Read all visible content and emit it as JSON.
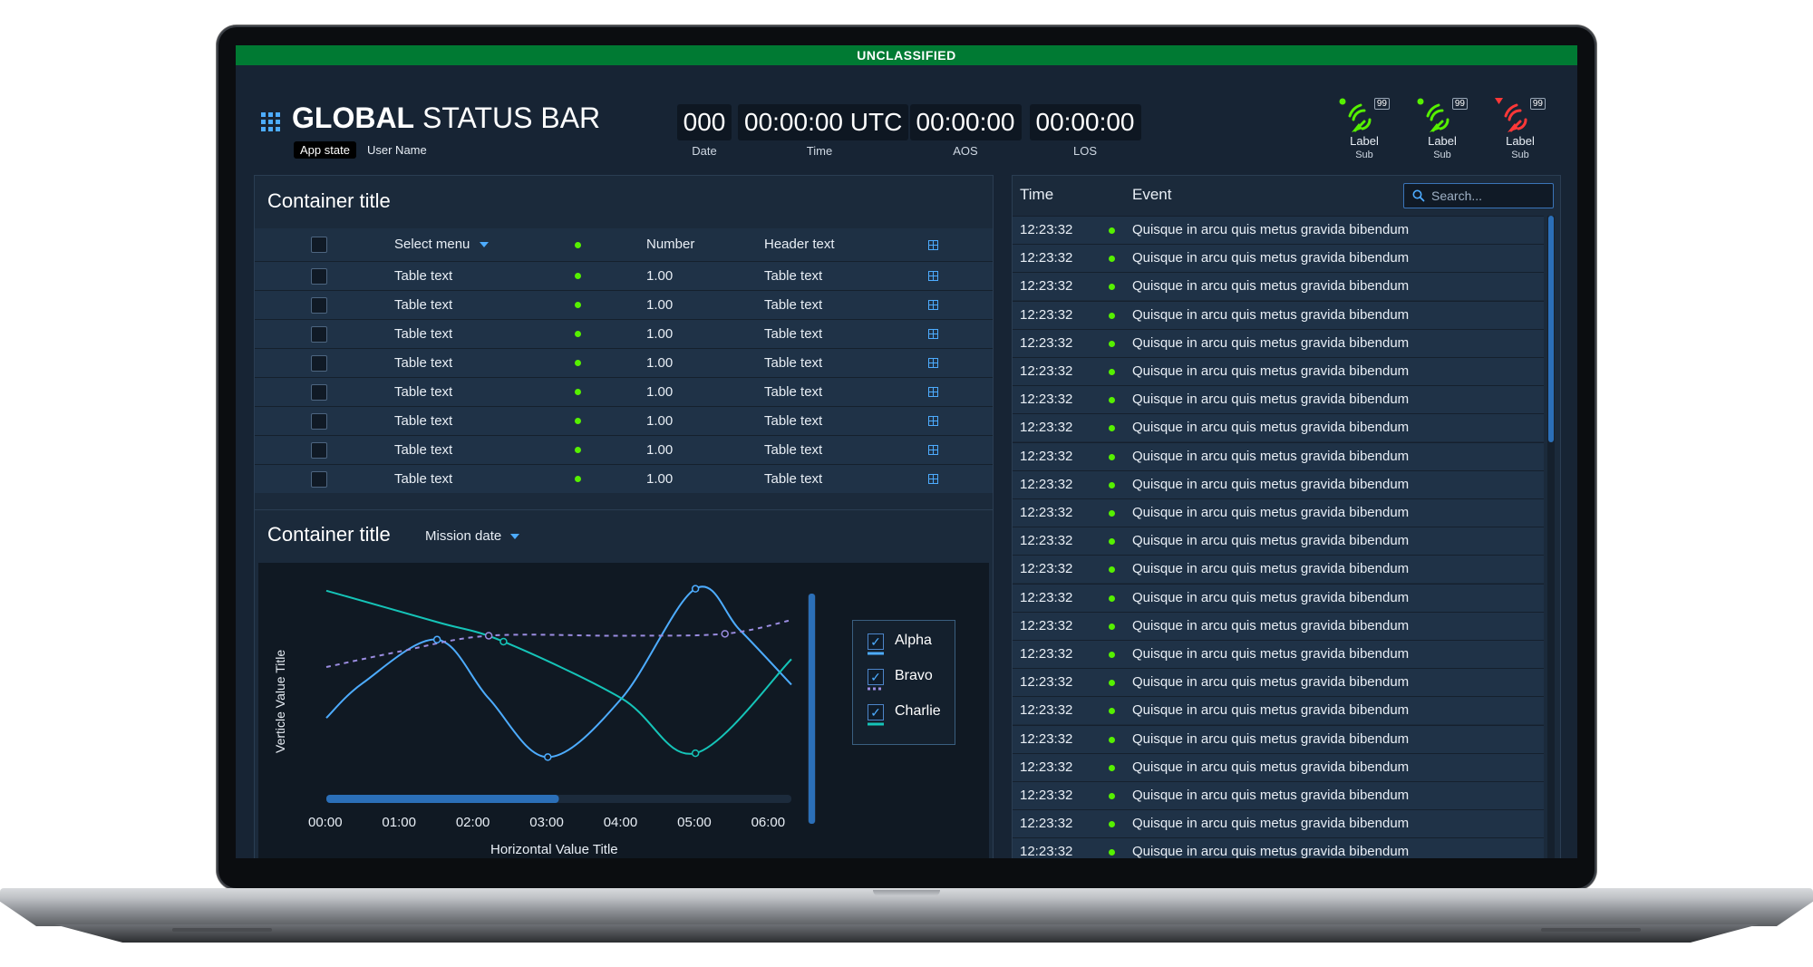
{
  "classification": "UNCLASSIFIED",
  "header": {
    "title_bold": "GLOBAL",
    "title_rest": "STATUS BAR",
    "app_state": "App state",
    "user_name": "User Name"
  },
  "clocks": [
    {
      "value": "000",
      "label": "Date"
    },
    {
      "value": "00:00:00 UTC",
      "label": "Time"
    },
    {
      "value": "00:00:00",
      "label": "AOS"
    },
    {
      "value": "00:00:00",
      "label": "LOS"
    }
  ],
  "monitors": [
    {
      "label": "Label",
      "sub": "Sub",
      "badge": "99",
      "status": "normal",
      "color": "#56f000"
    },
    {
      "label": "Label",
      "sub": "Sub",
      "badge": "99",
      "status": "normal",
      "color": "#56f000"
    },
    {
      "label": "Label",
      "sub": "Sub",
      "badge": "99",
      "status": "critical",
      "color": "#ff3838"
    }
  ],
  "table_panel": {
    "title": "Container title",
    "headers": {
      "select": "Select menu",
      "number": "Number",
      "text": "Header text"
    },
    "rows": [
      {
        "text": "Table text",
        "number": "1.00",
        "header_text": "Table text"
      },
      {
        "text": "Table text",
        "number": "1.00",
        "header_text": "Table text"
      },
      {
        "text": "Table text",
        "number": "1.00",
        "header_text": "Table text"
      },
      {
        "text": "Table text",
        "number": "1.00",
        "header_text": "Table text"
      },
      {
        "text": "Table text",
        "number": "1.00",
        "header_text": "Table text"
      },
      {
        "text": "Table text",
        "number": "1.00",
        "header_text": "Table text"
      },
      {
        "text": "Table text",
        "number": "1.00",
        "header_text": "Table text"
      },
      {
        "text": "Table text",
        "number": "1.00",
        "header_text": "Table text"
      }
    ]
  },
  "chart_panel": {
    "title": "Container title",
    "dropdown": "Mission date"
  },
  "chart_data": {
    "type": "line",
    "xlabel": "Horizontal Value Title",
    "ylabel": "Verticle Value Title",
    "x": [
      "00:00",
      "01:00",
      "02:00",
      "03:00",
      "04:00",
      "05:00",
      "06:00"
    ],
    "xlim": [
      0,
      6.3
    ],
    "ylim": [
      0,
      100
    ],
    "grid": false,
    "legend": "right",
    "series": [
      {
        "name": "Alpha",
        "color": "#4dacff",
        "style": "solid",
        "x": [
          0,
          0.5,
          1.5,
          2.2,
          3.0,
          4.0,
          5.0,
          5.6,
          6.3
        ],
        "y": [
          30,
          48,
          70,
          40,
          10,
          40,
          96,
          75,
          47
        ]
      },
      {
        "name": "Bravo",
        "color": "#9a8ce0",
        "style": "dashed",
        "x": [
          0,
          1.0,
          2.2,
          4.0,
          5.4,
          6.3
        ],
        "y": [
          56,
          64,
          72,
          72,
          73,
          80
        ]
      },
      {
        "name": "Charlie",
        "color": "#15c4b8",
        "style": "solid",
        "x": [
          0,
          1.5,
          2.4,
          4.0,
          5.0,
          6.3
        ],
        "y": [
          95,
          79,
          69,
          40,
          12,
          60
        ]
      }
    ],
    "markers": [
      {
        "series": "Alpha",
        "x": 1.5,
        "y": 70
      },
      {
        "series": "Alpha",
        "x": 3.0,
        "y": 10
      },
      {
        "series": "Alpha",
        "x": 5.0,
        "y": 96
      },
      {
        "series": "Bravo",
        "x": 2.2,
        "y": 72
      },
      {
        "series": "Bravo",
        "x": 5.4,
        "y": 73
      },
      {
        "series": "Charlie",
        "x": 2.4,
        "y": 69
      },
      {
        "series": "Charlie",
        "x": 5.0,
        "y": 12
      }
    ],
    "x_scroll": {
      "start": 0.0,
      "end": 0.5
    },
    "y_scroll": {
      "start": 0.0,
      "end": 1.0
    }
  },
  "event_log": {
    "headers": {
      "time": "Time",
      "event": "Event"
    },
    "search_placeholder": "Search...",
    "rows": [
      {
        "time": "12:23:32",
        "event": "Quisque in arcu quis metus gravida bibendum"
      },
      {
        "time": "12:23:32",
        "event": "Quisque in arcu quis metus gravida bibendum"
      },
      {
        "time": "12:23:32",
        "event": "Quisque in arcu quis metus gravida bibendum"
      },
      {
        "time": "12:23:32",
        "event": "Quisque in arcu quis metus gravida bibendum"
      },
      {
        "time": "12:23:32",
        "event": "Quisque in arcu quis metus gravida bibendum"
      },
      {
        "time": "12:23:32",
        "event": "Quisque in arcu quis metus gravida bibendum"
      },
      {
        "time": "12:23:32",
        "event": "Quisque in arcu quis metus gravida bibendum"
      },
      {
        "time": "12:23:32",
        "event": "Quisque in arcu quis metus gravida bibendum"
      },
      {
        "time": "12:23:32",
        "event": "Quisque in arcu quis metus gravida bibendum"
      },
      {
        "time": "12:23:32",
        "event": "Quisque in arcu quis metus gravida bibendum"
      },
      {
        "time": "12:23:32",
        "event": "Quisque in arcu quis metus gravida bibendum"
      },
      {
        "time": "12:23:32",
        "event": "Quisque in arcu quis metus gravida bibendum"
      },
      {
        "time": "12:23:32",
        "event": "Quisque in arcu quis metus gravida bibendum"
      },
      {
        "time": "12:23:32",
        "event": "Quisque in arcu quis metus gravida bibendum"
      },
      {
        "time": "12:23:32",
        "event": "Quisque in arcu quis metus gravida bibendum"
      },
      {
        "time": "12:23:32",
        "event": "Quisque in arcu quis metus gravida bibendum"
      },
      {
        "time": "12:23:32",
        "event": "Quisque in arcu quis metus gravida bibendum"
      },
      {
        "time": "12:23:32",
        "event": "Quisque in arcu quis metus gravida bibendum"
      },
      {
        "time": "12:23:32",
        "event": "Quisque in arcu quis metus gravida bibendum"
      },
      {
        "time": "12:23:32",
        "event": "Quisque in arcu quis metus gravida bibendum"
      },
      {
        "time": "12:23:32",
        "event": "Quisque in arcu quis metus gravida bibendum"
      },
      {
        "time": "12:23:32",
        "event": "Quisque in arcu quis metus gravida bibendum"
      },
      {
        "time": "12:23:32",
        "event": "Quisque in arcu quis metus gravida bibendum"
      }
    ]
  },
  "colors": {
    "classification": "#007a33",
    "status_normal": "#56f000",
    "status_critical": "#ff3838",
    "accent": "#4dacff"
  }
}
